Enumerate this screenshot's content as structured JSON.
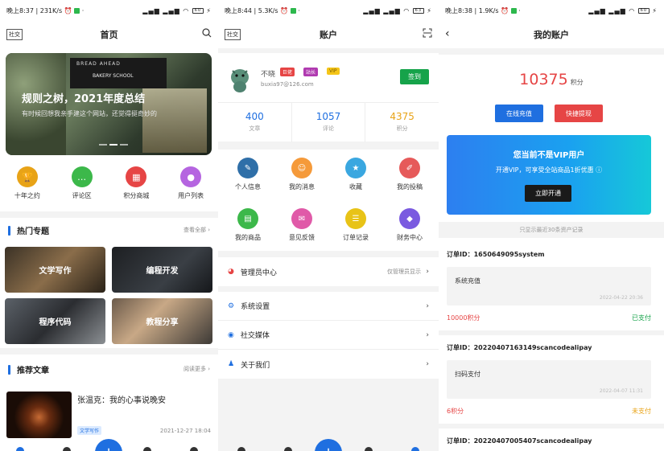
{
  "colors": {
    "accent": "#1f6fe0",
    "red": "#e64545",
    "green": "#16a34a",
    "orange": "#e8a317"
  },
  "panel1": {
    "status": {
      "time": "晚上8:37 | 231K/s",
      "battery": "60"
    },
    "nav": {
      "left_tag": "社交",
      "title": "首页",
      "right_icon": "search-icon"
    },
    "banner": {
      "title": "规则之树，2021年度总结",
      "subtitle": "有时候回想我亲手建这个网站，还觉得挺奇妙的",
      "sign": "BREAD AHEAD",
      "sign2": "BAKERY SCHOOL"
    },
    "quick": [
      {
        "label": "十年之约",
        "color": "#e8a317",
        "icon": "trophy-icon",
        "glyph": "🏆"
      },
      {
        "label": "评论区",
        "color": "#3cb84a",
        "icon": "comment-icon",
        "glyph": "…"
      },
      {
        "label": "积分商城",
        "color": "#e64545",
        "icon": "store-icon",
        "glyph": "▦"
      },
      {
        "label": "用户列表",
        "color": "#b565e0",
        "icon": "user-icon",
        "glyph": "●"
      }
    ],
    "hot": {
      "title": "热门专题",
      "more": "查看全部"
    },
    "topics": [
      "文学写作",
      "编程开发",
      "程序代码",
      "教程分享"
    ],
    "recommend": {
      "title": "推荐文章",
      "more": "阅读更多"
    },
    "article": {
      "title": "张温克：我的心事说晚安",
      "tag": "文学写作",
      "date": "2021-12-27 18:04"
    },
    "fab": "+"
  },
  "panel2": {
    "status": {
      "time": "晚上8:44 | 5.3K/s",
      "battery": "63"
    },
    "nav": {
      "left_tag": "社交",
      "title": "账户",
      "right_icon": "scan-icon"
    },
    "user": {
      "name": "不晓",
      "badges": [
        "巨佬",
        "站长",
        "VIP"
      ],
      "email": "buxia97@126.com",
      "sign_label": "签到"
    },
    "stats": [
      {
        "num": "400",
        "label": "文章",
        "color": "#1f6fe0"
      },
      {
        "num": "1057",
        "label": "评论",
        "color": "#1f6fe0"
      },
      {
        "num": "4375",
        "label": "积分",
        "color": "#e8a317"
      }
    ],
    "grid": [
      {
        "label": "个人信息",
        "color": "#2f6fa8",
        "icon": "edit-icon",
        "glyph": "✎"
      },
      {
        "label": "我的消息",
        "color": "#f59a3a",
        "icon": "message-icon",
        "glyph": "☺"
      },
      {
        "label": "收藏",
        "color": "#3aa7e0",
        "icon": "star-icon",
        "glyph": "★"
      },
      {
        "label": "我的投稿",
        "color": "#e65a5a",
        "icon": "pencil-icon",
        "glyph": "✐"
      },
      {
        "label": "我的商品",
        "color": "#3cb84a",
        "icon": "goods-icon",
        "glyph": "▤"
      },
      {
        "label": "意见反馈",
        "color": "#e05aa8",
        "icon": "feedback-icon",
        "glyph": "✉"
      },
      {
        "label": "订单记录",
        "color": "#e8c317",
        "icon": "order-icon",
        "glyph": "☰"
      },
      {
        "label": "财务中心",
        "color": "#7a5ae0",
        "icon": "diamond-icon",
        "glyph": "◆"
      }
    ],
    "admin": {
      "label": "管理员中心",
      "hint": "仅管理员显示"
    },
    "rows": [
      {
        "label": "系统设置",
        "icon": "gear-icon",
        "glyph": "⚙"
      },
      {
        "label": "社交媒体",
        "icon": "chat-icon",
        "glyph": "◉"
      },
      {
        "label": "关于我们",
        "icon": "about-icon",
        "glyph": "♟"
      }
    ]
  },
  "panel3": {
    "status": {
      "time": "晚上8:38 | 1.9K/s",
      "battery": "60"
    },
    "nav": {
      "title": "我的账户"
    },
    "points": {
      "value": "10375",
      "unit": "积分"
    },
    "buttons": {
      "recharge": "在线充值",
      "withdraw": "快捷提现"
    },
    "vip": {
      "title": "您当前不是VIP用户",
      "desc": "开通VIP，可享受全站商品1折优惠 ⓘ",
      "button": "立即开通"
    },
    "note": "只显示最近30条资产记录",
    "orders": [
      {
        "id": "订单ID：1650649095system",
        "type": "系统充值",
        "date": "2022-04-22 20:36",
        "pts": "10000积分",
        "status": "已支付",
        "status_color": "#16a34a"
      },
      {
        "id": "订单ID：20220407163149scancodealipay",
        "type": "扫码支付",
        "date": "2022-04-07 11:31",
        "pts": "6积分",
        "status": "未支付",
        "status_color": "#e8a317"
      },
      {
        "id": "订单ID：20220407005407scancodealipay"
      }
    ]
  }
}
